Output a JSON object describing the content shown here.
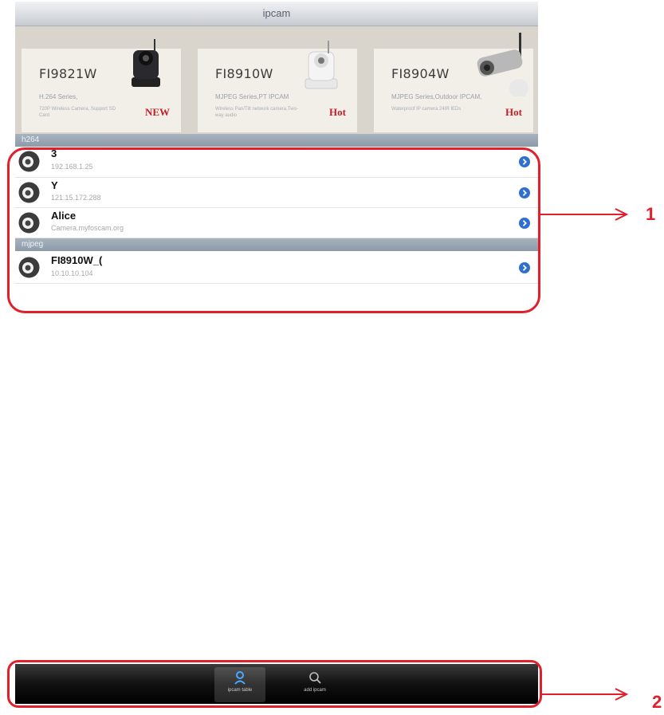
{
  "window": {
    "title": "ipcam"
  },
  "promos": [
    {
      "model": "FI9821W",
      "series": "H.264 Series,",
      "desc": "720P Wireless Camera, Support SD Card",
      "tag": "NEW",
      "camera_color": "#2a2a2e"
    },
    {
      "model": "FI8910W",
      "series": "MJPEG Series,PT IPCAM",
      "desc": "Wireless Pan/Tilt network camera,Two-way audio",
      "tag": "Hot",
      "camera_color": "#f4f4f4"
    },
    {
      "model": "FI8904W",
      "series": "MJPEG Series,Outdoor IPCAM,",
      "desc": "Waterproof IP camera 24IR IEDs",
      "tag": "Hot",
      "camera_color": "#b8b8b8"
    }
  ],
  "sections": [
    {
      "label": "h264",
      "rows": [
        {
          "name": "3",
          "address": "192.168.1.25"
        },
        {
          "name": "Y",
          "address": "121.15.172.288"
        },
        {
          "name": "Alice",
          "address": "Camera.myfoscam.org"
        }
      ]
    },
    {
      "label": "mjpeg",
      "rows": [
        {
          "name": "FI8910W_(",
          "address": "10.10.10.104"
        }
      ]
    }
  ],
  "tabs": [
    {
      "label": "ipcam table",
      "icon": "person-icon",
      "active": true
    },
    {
      "label": "add ipcam",
      "icon": "search-icon",
      "active": false
    }
  ],
  "callouts": [
    {
      "number": "1"
    },
    {
      "number": "2"
    }
  ],
  "colors": {
    "callout": "#e0202a",
    "disclosure": "#2f6fd0"
  }
}
